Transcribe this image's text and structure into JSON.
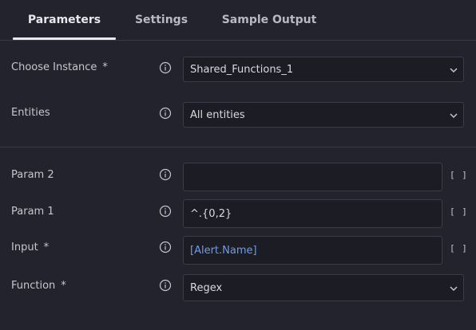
{
  "tabs": [
    {
      "label": "Parameters",
      "active": true
    },
    {
      "label": "Settings",
      "active": false
    },
    {
      "label": "Sample Output",
      "active": false
    }
  ],
  "fields": {
    "choose_instance": {
      "label": "Choose Instance",
      "required_mark": "*",
      "value": "Shared_Functions_1"
    },
    "entities": {
      "label": "Entities",
      "value": "All entities"
    },
    "param2": {
      "label": "Param 2",
      "value": "",
      "brackets": "[ ]"
    },
    "param1": {
      "label": "Param 1",
      "value": "^.{0,2}",
      "brackets": "[ ]"
    },
    "input": {
      "label": "Input",
      "required_mark": "*",
      "value": "[Alert.Name]",
      "brackets": "[ ]"
    },
    "function": {
      "label": "Function",
      "required_mark": "*",
      "value": "Regex"
    }
  },
  "icons": {
    "info": "info-circle-icon",
    "chevron": "chevron-down-icon"
  },
  "colors": {
    "background": "#23232d",
    "field_bg": "#1c1c24",
    "border": "#3c3c48",
    "placeholder_link": "#6e9de6",
    "active_tab_underline": "#e9e9ef"
  }
}
